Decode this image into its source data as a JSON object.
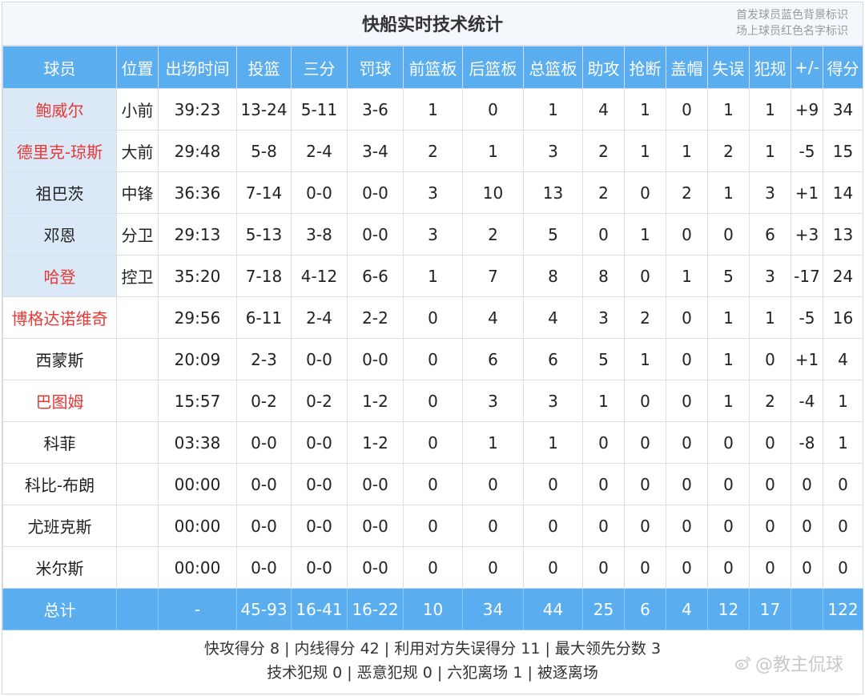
{
  "header": {
    "title": "快船实时技术统计",
    "legend_line1": "首发球员蓝色背景标识",
    "legend_line2": "场上球员红色名字标识"
  },
  "columns": [
    "球员",
    "位置",
    "出场时间",
    "投篮",
    "三分",
    "罚球",
    "前篮板",
    "后篮板",
    "总篮板",
    "助攻",
    "抢断",
    "盖帽",
    "失误",
    "犯规",
    "+/-",
    "得分"
  ],
  "players": [
    {
      "name": "鲍威尔",
      "pos": "小前",
      "min": "39:23",
      "fg": "13-24",
      "tp": "5-11",
      "ft": "3-6",
      "oreb": "1",
      "dreb": "0",
      "reb": "1",
      "ast": "4",
      "stl": "1",
      "blk": "0",
      "tov": "1",
      "pf": "1",
      "pm": "+9",
      "pts": "34",
      "starter": true,
      "oncourt": true
    },
    {
      "name": "德里克-琼斯",
      "pos": "大前",
      "min": "29:48",
      "fg": "5-8",
      "tp": "2-4",
      "ft": "3-4",
      "oreb": "2",
      "dreb": "1",
      "reb": "3",
      "ast": "2",
      "stl": "1",
      "blk": "1",
      "tov": "2",
      "pf": "1",
      "pm": "-5",
      "pts": "15",
      "starter": true,
      "oncourt": true
    },
    {
      "name": "祖巴茨",
      "pos": "中锋",
      "min": "36:36",
      "fg": "7-14",
      "tp": "0-0",
      "ft": "0-0",
      "oreb": "3",
      "dreb": "10",
      "reb": "13",
      "ast": "2",
      "stl": "0",
      "blk": "2",
      "tov": "1",
      "pf": "3",
      "pm": "+1",
      "pts": "14",
      "starter": true,
      "oncourt": false
    },
    {
      "name": "邓恩",
      "pos": "分卫",
      "min": "29:13",
      "fg": "5-13",
      "tp": "3-8",
      "ft": "0-0",
      "oreb": "3",
      "dreb": "2",
      "reb": "5",
      "ast": "0",
      "stl": "1",
      "blk": "0",
      "tov": "0",
      "pf": "6",
      "pm": "+3",
      "pts": "13",
      "starter": true,
      "oncourt": false
    },
    {
      "name": "哈登",
      "pos": "控卫",
      "min": "35:20",
      "fg": "7-18",
      "tp": "4-12",
      "ft": "6-6",
      "oreb": "1",
      "dreb": "7",
      "reb": "8",
      "ast": "8",
      "stl": "0",
      "blk": "1",
      "tov": "5",
      "pf": "3",
      "pm": "-17",
      "pts": "24",
      "starter": true,
      "oncourt": true
    },
    {
      "name": "博格达诺维奇",
      "pos": "",
      "min": "29:56",
      "fg": "6-11",
      "tp": "2-4",
      "ft": "2-2",
      "oreb": "0",
      "dreb": "4",
      "reb": "4",
      "ast": "3",
      "stl": "2",
      "blk": "0",
      "tov": "1",
      "pf": "1",
      "pm": "-5",
      "pts": "16",
      "starter": false,
      "oncourt": true
    },
    {
      "name": "西蒙斯",
      "pos": "",
      "min": "20:09",
      "fg": "2-3",
      "tp": "0-0",
      "ft": "0-0",
      "oreb": "0",
      "dreb": "6",
      "reb": "6",
      "ast": "5",
      "stl": "1",
      "blk": "0",
      "tov": "1",
      "pf": "0",
      "pm": "+1",
      "pts": "4",
      "starter": false,
      "oncourt": false
    },
    {
      "name": "巴图姆",
      "pos": "",
      "min": "15:57",
      "fg": "0-2",
      "tp": "0-2",
      "ft": "1-2",
      "oreb": "0",
      "dreb": "3",
      "reb": "3",
      "ast": "1",
      "stl": "0",
      "blk": "0",
      "tov": "1",
      "pf": "2",
      "pm": "-4",
      "pts": "1",
      "starter": false,
      "oncourt": true
    },
    {
      "name": "科菲",
      "pos": "",
      "min": "03:38",
      "fg": "0-0",
      "tp": "0-0",
      "ft": "1-2",
      "oreb": "0",
      "dreb": "1",
      "reb": "1",
      "ast": "0",
      "stl": "0",
      "blk": "0",
      "tov": "0",
      "pf": "0",
      "pm": "-8",
      "pts": "1",
      "starter": false,
      "oncourt": false
    },
    {
      "name": "科比-布朗",
      "pos": "",
      "min": "00:00",
      "fg": "0-0",
      "tp": "0-0",
      "ft": "0-0",
      "oreb": "0",
      "dreb": "0",
      "reb": "0",
      "ast": "0",
      "stl": "0",
      "blk": "0",
      "tov": "0",
      "pf": "0",
      "pm": "0",
      "pts": "0",
      "starter": false,
      "oncourt": false
    },
    {
      "name": "尤班克斯",
      "pos": "",
      "min": "00:00",
      "fg": "0-0",
      "tp": "0-0",
      "ft": "0-0",
      "oreb": "0",
      "dreb": "0",
      "reb": "0",
      "ast": "0",
      "stl": "0",
      "blk": "0",
      "tov": "0",
      "pf": "0",
      "pm": "0",
      "pts": "0",
      "starter": false,
      "oncourt": false
    },
    {
      "name": "米尔斯",
      "pos": "",
      "min": "00:00",
      "fg": "0-0",
      "tp": "0-0",
      "ft": "0-0",
      "oreb": "0",
      "dreb": "0",
      "reb": "0",
      "ast": "0",
      "stl": "0",
      "blk": "0",
      "tov": "0",
      "pf": "0",
      "pm": "0",
      "pts": "0",
      "starter": false,
      "oncourt": false
    }
  ],
  "totals": {
    "name": "总计",
    "pos": "",
    "min": "-",
    "fg": "45-93",
    "tp": "16-41",
    "ft": "16-22",
    "oreb": "10",
    "dreb": "34",
    "reb": "44",
    "ast": "25",
    "stl": "6",
    "blk": "4",
    "tov": "12",
    "pf": "17",
    "pm": "",
    "pts": "122"
  },
  "summary": {
    "line1": "快攻得分 8 | 内线得分 42 | 利用对方失误得分 11 | 最大领先分数 3",
    "line2": "技术犯规 0 | 恶意犯规 0 | 六犯离场 1 | 被逐离场"
  },
  "watermark": {
    "text": "@教主侃球",
    "icon": "weibo-icon"
  },
  "colors": {
    "header_blue": "#5aaef0",
    "starter_bg": "#dbe8f7",
    "oncourt_red": "#e53935"
  }
}
